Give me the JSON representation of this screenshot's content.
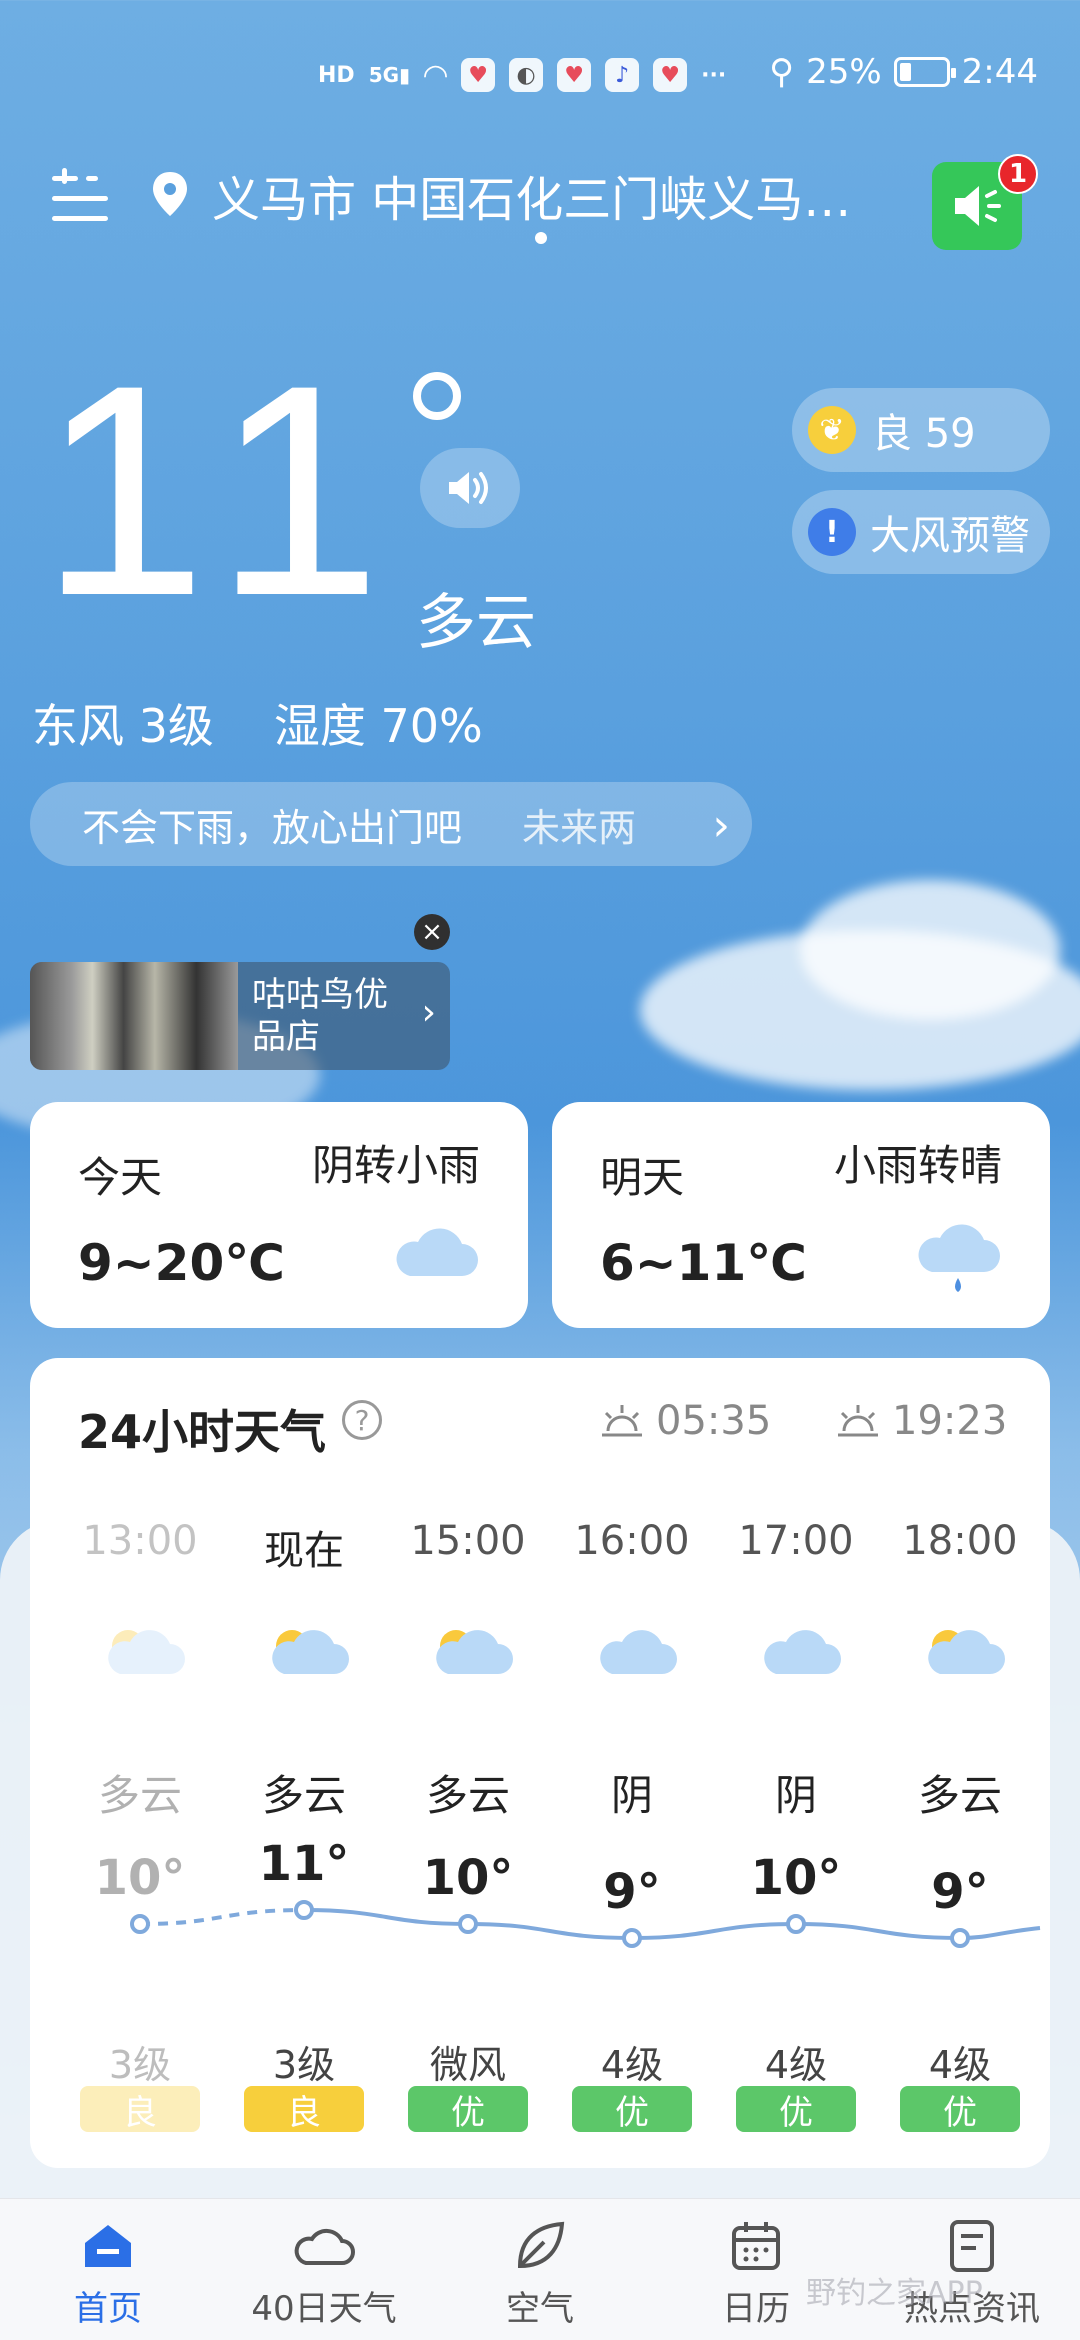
{
  "status_bar": {
    "battery": "25%",
    "time": "2:44",
    "network": "5G"
  },
  "header": {
    "location": "义马市 中国石化三门峡义马…",
    "notification_count": "1"
  },
  "current": {
    "temperature": "11",
    "condition": "多云",
    "aqi_label": "良 59",
    "warning": "大风预警",
    "wind": "东风 3级",
    "humidity": "湿度 70%",
    "tip_main": "不会下雨，放心出门吧",
    "tip_more": "未来两"
  },
  "ad": {
    "title": "咕咕鸟优品店"
  },
  "today": {
    "label": "今天",
    "condition": "阴转小雨",
    "range": "9~20℃"
  },
  "tomorrow": {
    "label": "明天",
    "condition": "小雨转晴",
    "range": "6~11℃"
  },
  "hourly": {
    "title": "24小时天气",
    "sunrise": "05:35",
    "sunset": "19:23",
    "items": [
      {
        "time": "13:00",
        "condition": "多云",
        "temp": "10°",
        "wind": "3级",
        "aqi": "良",
        "icon": "partly-cloudy-icon"
      },
      {
        "time": "现在",
        "condition": "多云",
        "temp": "11°",
        "wind": "3级",
        "aqi": "良",
        "icon": "partly-cloudy-icon"
      },
      {
        "time": "15:00",
        "condition": "多云",
        "temp": "10°",
        "wind": "微风",
        "aqi": "优",
        "icon": "partly-cloudy-icon"
      },
      {
        "time": "16:00",
        "condition": "阴",
        "temp": "9°",
        "wind": "4级",
        "aqi": "优",
        "icon": "cloud-icon"
      },
      {
        "time": "17:00",
        "condition": "阴",
        "temp": "10°",
        "wind": "4级",
        "aqi": "优",
        "icon": "cloud-icon"
      },
      {
        "time": "18:00",
        "condition": "多云",
        "temp": "9°",
        "wind": "4级",
        "aqi": "优",
        "icon": "partly-cloudy-icon"
      }
    ]
  },
  "nav": [
    {
      "label": "首页",
      "icon": "home-icon"
    },
    {
      "label": "40日天气",
      "icon": "cloud-icon"
    },
    {
      "label": "空气",
      "icon": "leaf-icon"
    },
    {
      "label": "日历",
      "icon": "calendar-icon"
    },
    {
      "label": "热点资讯",
      "icon": "news-icon"
    }
  ],
  "watermark": "野钓之家APP",
  "colors": {
    "accent": "#2b6fe6",
    "aqi_good": "#f7cf3c",
    "aqi_excellent": "#5cc769",
    "warning": "#3f7de8",
    "notify": "#35c759"
  }
}
